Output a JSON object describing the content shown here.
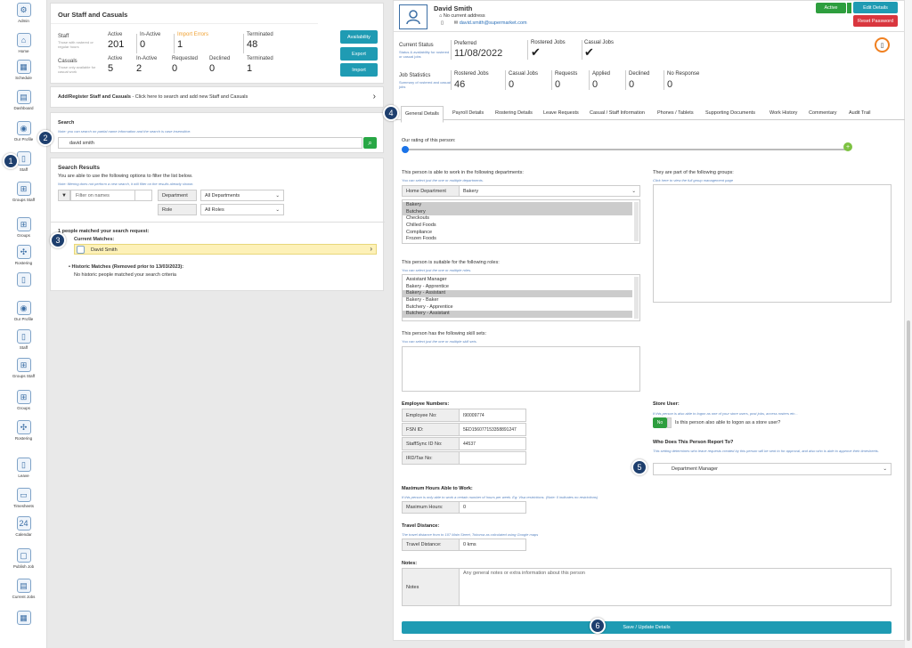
{
  "sidebar": {
    "items": [
      {
        "label": "Admin",
        "icon": "gear-icon",
        "glyph": "⚙"
      },
      {
        "label": "Home",
        "icon": "home-icon",
        "glyph": "⌂"
      },
      {
        "label": "Schedule",
        "icon": "schedule-icon",
        "glyph": "▦"
      },
      {
        "label": "Dashboard",
        "icon": "dashboard-icon",
        "glyph": "▤"
      },
      {
        "label": "Our Profile",
        "icon": "profile-icon",
        "glyph": "◉"
      },
      {
        "label": "Staff",
        "icon": "staff-icon",
        "glyph": "▯"
      },
      {
        "label": "Groups Staff",
        "icon": "groups-staff-icon",
        "glyph": "⊞"
      },
      {
        "label": "Groups",
        "icon": "groups-icon",
        "glyph": "⊞"
      },
      {
        "label": "Rostering",
        "icon": "rostering-icon",
        "glyph": "✣"
      },
      {
        "label": "",
        "icon": "document-icon",
        "glyph": "▯"
      },
      {
        "label": "Our Profile",
        "icon": "profile-icon-2",
        "glyph": "◉"
      },
      {
        "label": "Staff",
        "icon": "staff-icon-2",
        "glyph": "▯"
      },
      {
        "label": "Groups Staff",
        "icon": "groups-staff-icon-2",
        "glyph": "⊞"
      },
      {
        "label": "Groups",
        "icon": "groups-icon-2",
        "glyph": "⊞"
      },
      {
        "label": "Rostering",
        "icon": "rostering-icon-2",
        "glyph": "✣"
      },
      {
        "label": "Leave",
        "icon": "leave-icon",
        "glyph": "▯"
      },
      {
        "label": "Timesheets",
        "icon": "timesheets-icon",
        "glyph": "▭"
      },
      {
        "label": "Calendar",
        "icon": "calendar-icon",
        "glyph": "24"
      },
      {
        "label": "Publish Job",
        "icon": "publish-job-icon",
        "glyph": "▢"
      },
      {
        "label": "Current Jobs",
        "icon": "current-jobs-icon",
        "glyph": "▤"
      },
      {
        "label": "",
        "icon": "more-icon",
        "glyph": "▦"
      }
    ]
  },
  "staff_panel": {
    "title": "Our Staff and Casuals",
    "staff_label": "Staff",
    "staff_note": "Those with rostered or regular hours",
    "casuals_label": "Casuals",
    "casuals_note": "Those only available for casual work",
    "headers_staff": [
      "Active",
      "In-Active",
      "Import Errors",
      "Terminated"
    ],
    "staff_values": [
      "201",
      "0",
      "1",
      "48"
    ],
    "headers_casuals": [
      "Active",
      "In-Active",
      "Requested",
      "Declined",
      "Terminated"
    ],
    "casual_values": [
      "5",
      "2",
      "0",
      "0",
      "1"
    ],
    "buttons": [
      "Availability",
      "Export",
      "Import"
    ],
    "import_errors_color": "#f0a030"
  },
  "add_register": {
    "bold": "Add/Register Staff and Casuals",
    "text": " - Click here to search and add new Staff and Casuals",
    "chevron": "›"
  },
  "search": {
    "title": "Search",
    "note": "Note: you can search on partial name information and the search is case insensitive.",
    "value": "david smith",
    "button_glyph": "⌕"
  },
  "results": {
    "title": "Search Results",
    "subtitle": "You are able to use the following options to filter the list below.",
    "note": "Note: filtering does not perform a new search, it will filter on the results already shown.",
    "filter_placeholder": "Filter on names",
    "filter_glyph": "▼",
    "department_label": "Department",
    "department_value": "All Departments",
    "role_label": "Role",
    "role_value": "All Roles",
    "matched_text": "1 people matched your search request:",
    "current_matches": "Current Matches:",
    "result_name": "David Smith",
    "historic_title": "Historic Matches (Removed prior to 13/03/2023):",
    "historic_text": "No historic people matched your search criteria"
  },
  "person": {
    "name": "David Smith",
    "address": "No current address",
    "email": "david.smith@supermarket.com",
    "status_button": "Active",
    "edit_button": "Edit Details",
    "reset_button": "Reset Password",
    "current_status_label": "Current Status",
    "current_status_note": "Status & availability for rostered or casual jobs",
    "preferred_label": "Preferred",
    "preferred_value": "11/08/2022",
    "rostered_jobs_label": "Rostered Jobs",
    "casual_jobs_label": "Casual Jobs",
    "job_stats_label": "Job Statistics",
    "job_stats_note": "Summary of rostered and casual jobs",
    "stat_headers": [
      "Rostered Jobs",
      "Casual Jobs",
      "Requests",
      "Applied",
      "Declined",
      "No Response"
    ],
    "stat_values": [
      "46",
      "0",
      "0",
      "0",
      "0",
      "0"
    ]
  },
  "tabs": [
    "General Details",
    "Payroll Details",
    "Rostering Details",
    "Leave Requests",
    "Casual / Staff Information",
    "Phones / Tablets",
    "Supporting Documents",
    "Work History",
    "Commentary",
    "Audit Trail"
  ],
  "general": {
    "rating_label": "Our rating of this person:",
    "departments_label": "This person is able to work in the following departments:",
    "departments_note": "You can select just the one or multiple departments.",
    "home_department_label": "Home Department",
    "home_department_value": "Bakery",
    "departments": [
      {
        "name": "Bakery",
        "selected": true
      },
      {
        "name": "Butchery",
        "selected": true
      },
      {
        "name": "Checkouts",
        "selected": false
      },
      {
        "name": "Chilled Foods",
        "selected": false
      },
      {
        "name": "Compliance",
        "selected": false
      },
      {
        "name": "Frozen Foods",
        "selected": false
      }
    ],
    "groups_label": "They are part of the following groups:",
    "groups_note": "Click here to view the full group management page",
    "roles_label": "This person is suitable for the following roles:",
    "roles_note": "You can select just the one or multiple roles.",
    "roles": [
      {
        "name": "Assistant Manager",
        "selected": false
      },
      {
        "name": "Bakery - Apprentice",
        "selected": false
      },
      {
        "name": "Bakery - Assistant",
        "selected": true
      },
      {
        "name": "Bakery - Baker",
        "selected": false
      },
      {
        "name": "Butchery - Apprentice",
        "selected": false
      },
      {
        "name": "Butchery - Assistant",
        "selected": true
      }
    ],
    "skills_label": "This person has the following skill sets:",
    "skills_note": "You can select just the one or multiple skill sets.",
    "employee_numbers_label": "Employee Numbers:",
    "employee_fields": [
      {
        "label": "Employee No:",
        "value": "I90009774"
      },
      {
        "label": "FSN ID:",
        "value": "5ED156077153358891247"
      },
      {
        "label": "StaffSync ID No:",
        "value": "44537"
      },
      {
        "label": "IRD/Tax No:",
        "value": ""
      }
    ],
    "store_user_label": "Store User:",
    "store_user_note": "If this person is also able to logon as one of your store users, post jobs, access rosters etc...",
    "store_user_toggle": "No",
    "store_user_question": "Is this person also able to logon as a store user?",
    "report_to_label": "Who Does This Person Report To?",
    "report_to_note": "This setting determines who leave requests created by this person will be sent to for approval, and also who is able to approve their timesheets.",
    "report_to_value": "Department Manager",
    "max_hours_label": "Maximum Hours Able to Work:",
    "max_hours_note": "If this person is only able to work a certain number of hours per week. Eg: Visa restrictions. (Note: 0 indicates no restrictions)",
    "max_hours_field": "Maximum Hours:",
    "max_hours_value": "0",
    "travel_label": "Travel Distance:",
    "travel_note": "The travel distance from to 107 Main Street, Tokoroa as calculated using Google maps",
    "travel_field": "Travel Distance:",
    "travel_value": "0 kms",
    "notes_label": "Notes:",
    "notes_field": "Notes",
    "notes_placeholder": "Any general notes or extra information about this person",
    "save_button": "Save / Update Details"
  },
  "callouts": [
    "1",
    "2",
    "3",
    "4",
    "5",
    "6"
  ],
  "colors": {
    "accent": "#1f9bb3",
    "active_green": "#2e9e3e",
    "reset_red": "#d9363e",
    "callout": "#1e3f6e"
  }
}
